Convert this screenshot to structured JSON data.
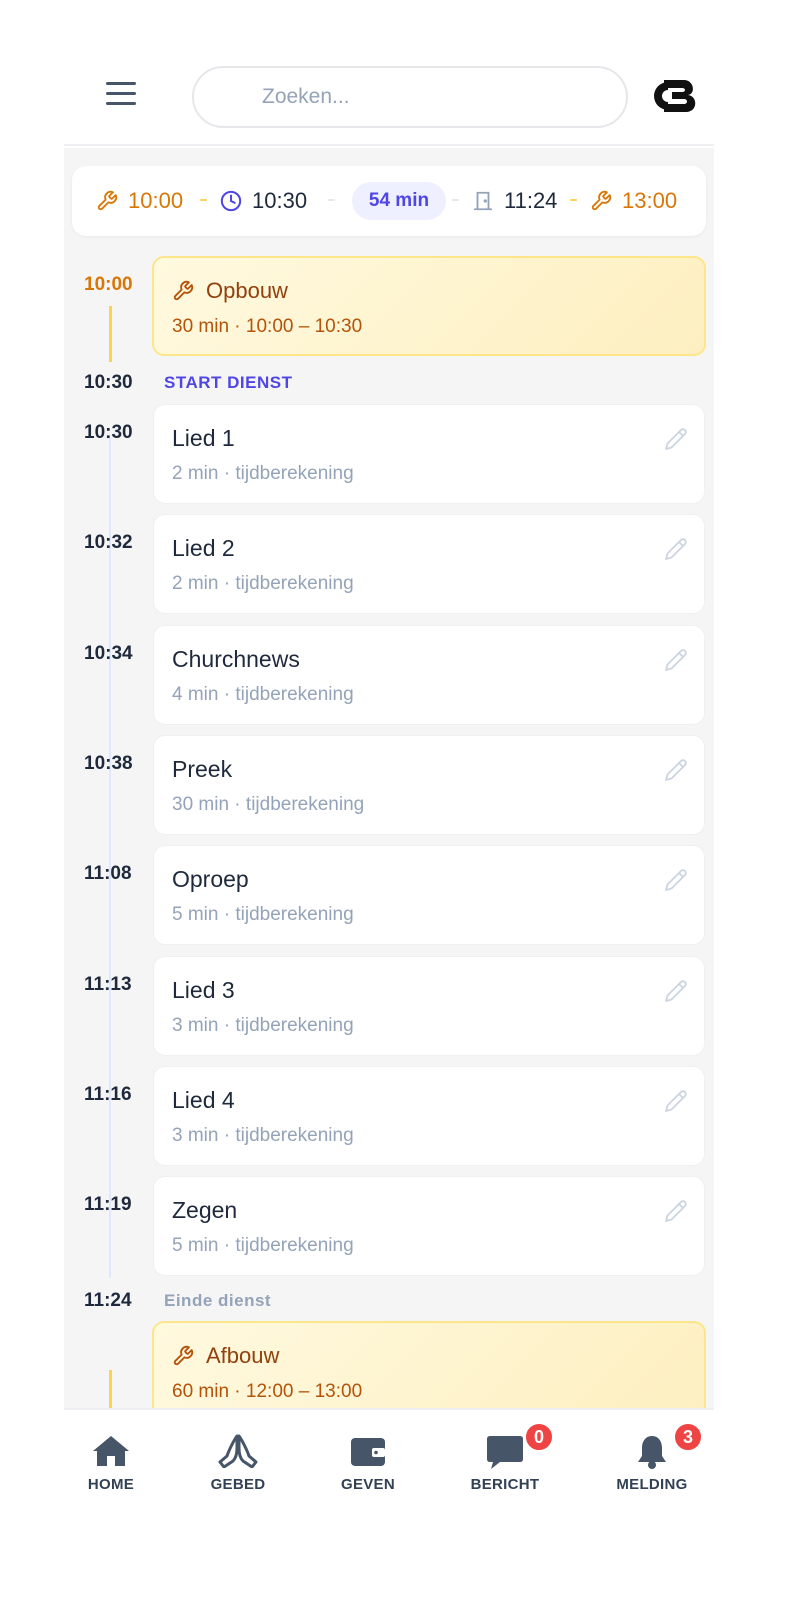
{
  "search": {
    "placeholder": "Zoeken..."
  },
  "summary": {
    "setup_start": "10:00",
    "service_start": "10:30",
    "duration": "54 min",
    "service_end": "11:24",
    "teardown_end": "13:00"
  },
  "setup": {
    "time": "10:00",
    "title": "Opbouw",
    "sub": "30 min · 10:00 – 10:30"
  },
  "start_marker": {
    "time": "10:30",
    "label": "START DIENST"
  },
  "items": [
    {
      "time": "10:30",
      "title": "Lied 1",
      "sub": "2 min · tijdberekening"
    },
    {
      "time": "10:32",
      "title": "Lied 2",
      "sub": "2 min · tijdberekening"
    },
    {
      "time": "10:34",
      "title": "Churchnews",
      "sub": "4 min · tijdberekening"
    },
    {
      "time": "10:38",
      "title": "Preek",
      "sub": "30 min · tijdberekening"
    },
    {
      "time": "11:08",
      "title": "Oproep",
      "sub": "5 min · tijdberekening"
    },
    {
      "time": "11:13",
      "title": "Lied 3",
      "sub": "3 min · tijdberekening"
    },
    {
      "time": "11:16",
      "title": "Lied 4",
      "sub": "3 min · tijdberekening"
    },
    {
      "time": "11:19",
      "title": "Zegen",
      "sub": "5 min · tijdberekening"
    }
  ],
  "end_marker": {
    "time": "11:24",
    "label": "Einde dienst"
  },
  "teardown": {
    "title": "Afbouw",
    "sub": "60 min · 12:00 – 13:00"
  },
  "nav": {
    "home": "HOME",
    "gebed": "GEBED",
    "geven": "GEVEN",
    "bericht": "BERICHT",
    "bericht_badge": "0",
    "melding": "MELDING",
    "melding_badge": "3"
  },
  "colors": {
    "accent": "#4f46e5",
    "setup": "#d97706",
    "badge": "#ef4444"
  },
  "icons": [
    "menu-icon",
    "wrench-icon",
    "clock-icon",
    "door-icon",
    "edit-icon",
    "home-icon",
    "praying-hands-icon",
    "wallet-icon",
    "chat-icon",
    "bell-icon"
  ]
}
